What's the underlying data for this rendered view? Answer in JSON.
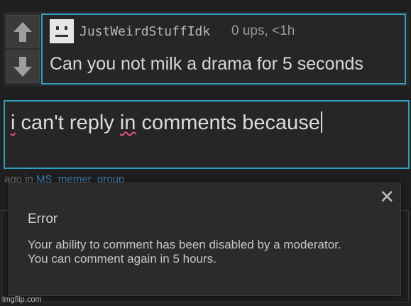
{
  "comment": {
    "username": "JustWeirdStuffIdk",
    "meta": "0 ups, <1h",
    "text": "Can you not milk a drama for 5 seconds",
    "upvote_icon": "arrow-up-icon",
    "downvote_icon": "arrow-down-icon",
    "avatar_icon": "blocky-face-avatar"
  },
  "reply": {
    "parts": [
      "i",
      " can't reply ",
      "in",
      " comments because"
    ]
  },
  "background": {
    "line_prefix": "ago in ",
    "line_link": "MS_memer_group"
  },
  "modal": {
    "close_label": "✕",
    "title": "Error",
    "message": "Your ability to comment has been disabled by a moderator. You can comment again in 5 hours."
  },
  "watermark": "imgflip.com",
  "colors": {
    "accent_border": "#2d9fc1",
    "background": "#1f1f1f",
    "spellcheck_underline": "#e0546f"
  }
}
